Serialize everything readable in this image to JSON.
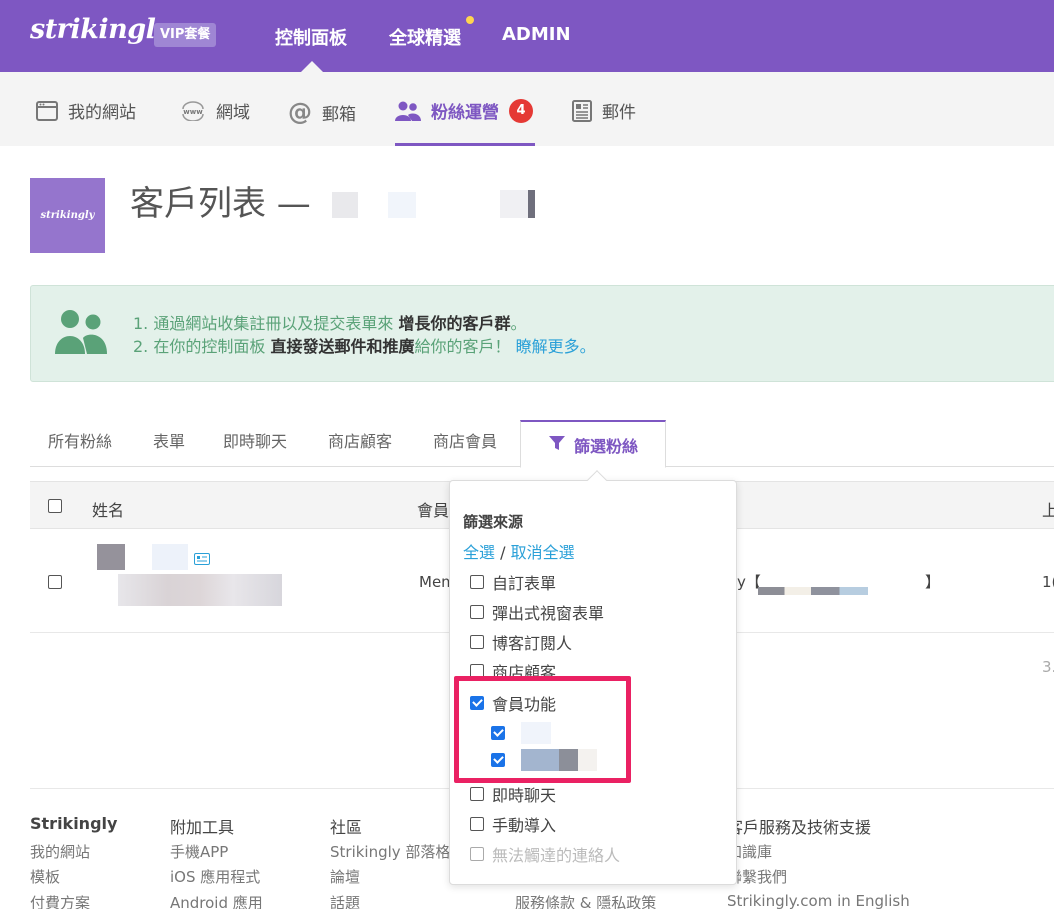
{
  "topbar": {
    "logo": "strikingly",
    "vip_badge": "VIP套餐",
    "nav": [
      "控制面板",
      "全球精選",
      "ADMIN"
    ]
  },
  "subnav": {
    "items": [
      {
        "label": "我的網站",
        "icon": "browser-window-icon"
      },
      {
        "label": "網域",
        "icon": "www-icon"
      },
      {
        "label": "郵箱",
        "icon": "at-sign-icon"
      },
      {
        "label": "粉絲運營",
        "icon": "users-icon",
        "badge": "4",
        "active": true
      },
      {
        "label": "郵件",
        "icon": "newsletter-icon"
      }
    ]
  },
  "site": {
    "thumb_text": "strikingly",
    "title": "客戶列表 —"
  },
  "banner": {
    "line1_prefix": "1. 通過網站收集註冊以及提交表單來 ",
    "line1_bold": "增長你的客戶群",
    "line1_suffix": "。",
    "line2_prefix": "2. 在你的控制面板 ",
    "line2_bold": "直接發送郵件和推廣",
    "line2_mid": "給你的客戶！ ",
    "line2_link": "瞭解更多。"
  },
  "tabs": [
    "所有粉絲",
    "表單",
    "即時聊天",
    "商店顧客",
    "商店會員"
  ],
  "active_tab": "篩選粉絲",
  "table": {
    "headers": {
      "name": "姓名",
      "member": "會員",
      "upper": "上"
    },
    "row": {
      "member": "Mem",
      "source_prefix": "y【",
      "source_suffix": "】",
      "date_right": "1("
    },
    "pagination_right": "3."
  },
  "filter": {
    "title": "篩選來源",
    "select_all": "全選",
    "separator": " / ",
    "deselect_all": "取消全選",
    "options": [
      {
        "label": "自訂表單",
        "checked": false
      },
      {
        "label": "彈出式視窗表單",
        "checked": false
      },
      {
        "label": "博客訂閱人",
        "checked": false
      },
      {
        "label": "商店顧客",
        "checked": false
      },
      {
        "label": "會員功能",
        "checked": true
      },
      {
        "label": "",
        "checked": true
      },
      {
        "label": "",
        "checked": true
      },
      {
        "label": "即時聊天",
        "checked": false
      },
      {
        "label": "手動導入",
        "checked": false
      },
      {
        "label": "無法觸達的連絡人",
        "checked": false,
        "disabled": true
      }
    ]
  },
  "footer": {
    "col1": {
      "title": "Strikingly",
      "links": [
        "我的網站",
        "模板",
        "付費方案"
      ]
    },
    "col2": {
      "title": "附加工具",
      "links": [
        "手機APP",
        "iOS 應用程式",
        "Android 應用"
      ]
    },
    "col3": {
      "title": "社區",
      "links": [
        "Strikingly 部落格",
        "論壇",
        "話題"
      ]
    },
    "col4": {
      "links": [
        "服務條款 & 隱私政策"
      ]
    },
    "col5": {
      "title": "客戶服務及技術支援",
      "links": [
        "知識庫",
        "聯繫我們",
        "Strikingly.com in English"
      ]
    }
  }
}
